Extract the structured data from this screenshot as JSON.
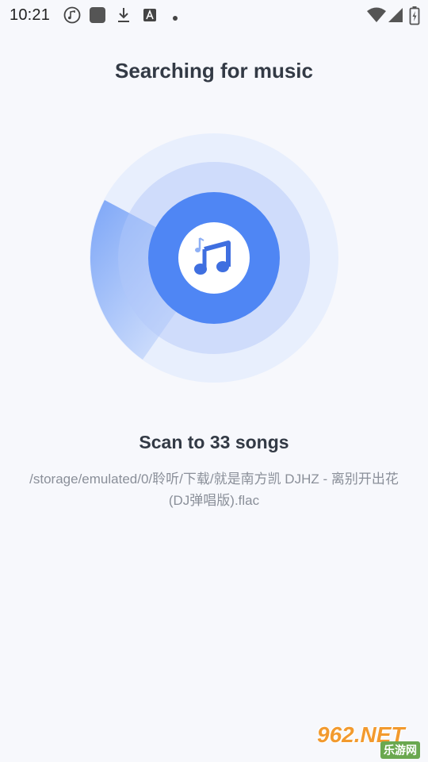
{
  "status_bar": {
    "time": "10:21",
    "icons": [
      "music-note-circle-icon",
      "app-square-icon",
      "download-icon",
      "font-a-icon",
      "dot-icon",
      "wifi-icon",
      "signal-icon",
      "battery-icon"
    ]
  },
  "main": {
    "title": "Searching for music",
    "scan_count": "Scan to 33 songs",
    "current_path": "/storage/emulated/0/聆听/下载/就是南方凯 DJHZ - 离别开出花 (DJ弹唱版).flac"
  },
  "watermark": {
    "main": "962.NET",
    "sub": "乐游网"
  },
  "colors": {
    "background": "#f7f8fc",
    "accent": "#4f86f4",
    "ring_outer": "#e8effd",
    "ring_mid": "#cfdcfb",
    "text_primary": "#333a45",
    "text_secondary": "#8a8f99"
  }
}
